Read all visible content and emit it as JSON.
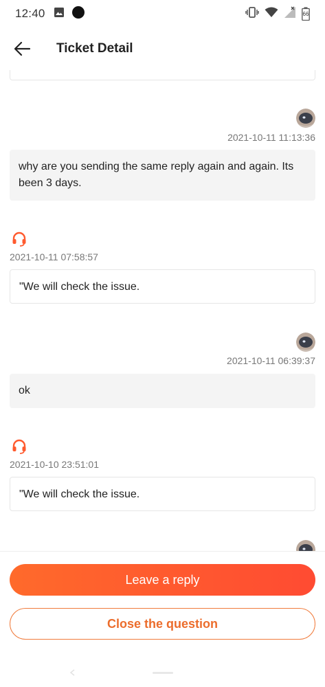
{
  "status_bar": {
    "time": "12:40",
    "battery": "66"
  },
  "header": {
    "title": "Ticket Detail"
  },
  "messages": [
    {
      "sender": "user",
      "timestamp": "2021-10-11 11:13:36",
      "text": "why are you sending the same reply again and again. Its been 3 days."
    },
    {
      "sender": "support",
      "timestamp": "2021-10-11 07:58:57",
      "text": "\"We will check the issue."
    },
    {
      "sender": "user",
      "timestamp": "2021-10-11 06:39:37",
      "text": "ok"
    },
    {
      "sender": "support",
      "timestamp": "2021-10-10 23:51:01",
      "text": "\"We will check the issue."
    }
  ],
  "actions": {
    "reply_label": "Leave a reply",
    "close_label": "Close the question"
  },
  "colors": {
    "accent": "#ff5a2e",
    "accent_border": "#f07a3a"
  }
}
